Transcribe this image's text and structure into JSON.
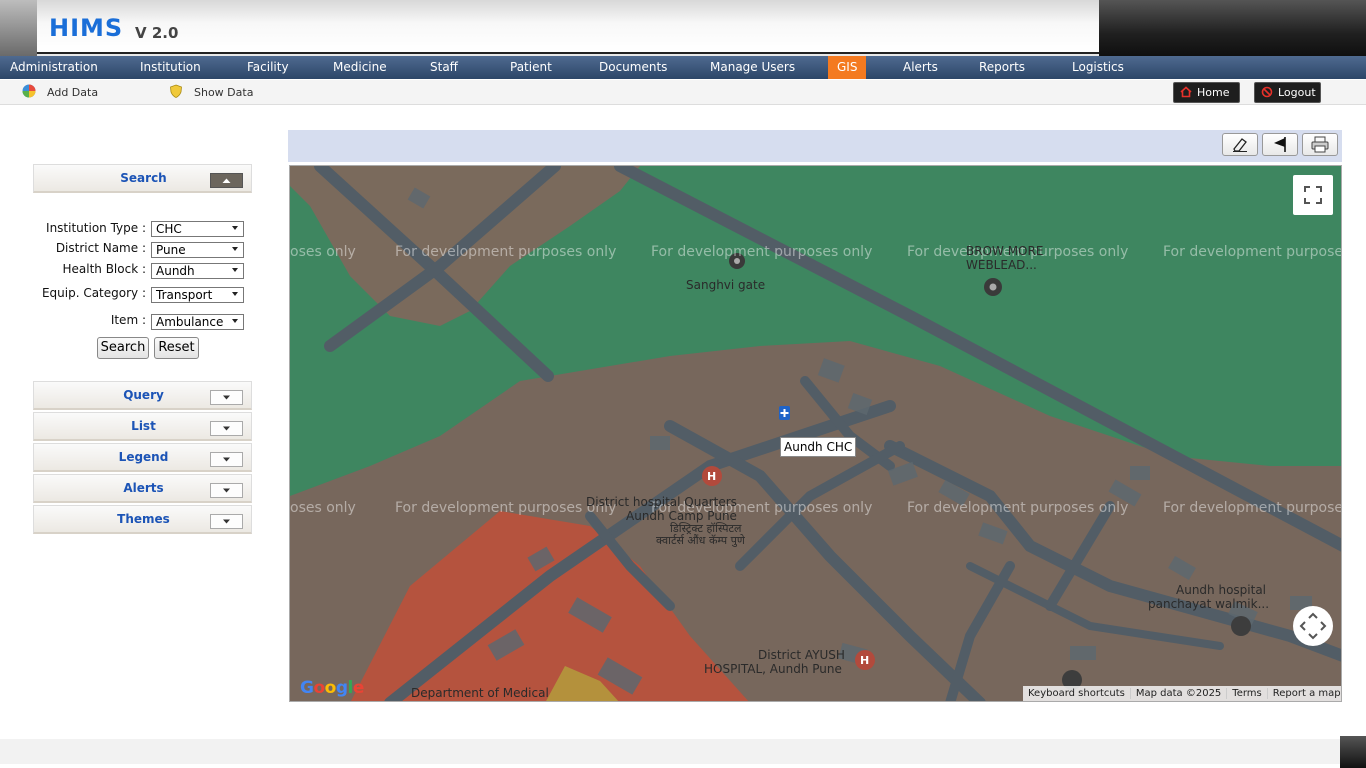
{
  "header": {
    "logo": "HIMS",
    "version": "V 2.0"
  },
  "nav": {
    "items": [
      {
        "label": "Administration"
      },
      {
        "label": "Institution"
      },
      {
        "label": "Facility"
      },
      {
        "label": "Medicine"
      },
      {
        "label": "Staff"
      },
      {
        "label": "Patient"
      },
      {
        "label": "Documents"
      },
      {
        "label": "Manage Users"
      },
      {
        "label": "GIS",
        "active": true
      },
      {
        "label": "Alerts"
      },
      {
        "label": "Reports"
      },
      {
        "label": "Logistics"
      }
    ],
    "active_color": "#f47a20"
  },
  "subnav": {
    "add_data": "Add Data",
    "show_data": "Show Data",
    "home": "Home",
    "logout": "Logout"
  },
  "left_panel": {
    "search": {
      "title": "Search",
      "fields": [
        {
          "label": "Institution Type :",
          "value": "CHC"
        },
        {
          "label": "District Name :",
          "value": "Pune"
        },
        {
          "label": "Health Block :",
          "value": "Aundh"
        },
        {
          "label": "Equip. Category :",
          "value": "Transport"
        },
        {
          "label": "Item :",
          "value": "Ambulance"
        }
      ],
      "search_button": "Search",
      "reset_button": "Reset"
    },
    "sections": [
      "Query",
      "List",
      "Legend",
      "Alerts",
      "Themes"
    ]
  },
  "map": {
    "watermark": "For development purposes only",
    "watermark_cut_left": "oses only",
    "watermark_cut_right": "For development purposes",
    "marker_tooltip": "Aundh CHC",
    "places": {
      "sanghvi": "Sanghvi gate",
      "brow": "BROW MORE",
      "weblead": "WEBLEAD...",
      "district_hospital": "District hospital Quarters",
      "aundh_camp": "Aundh Camp Pune",
      "marathi_1": "डिस्ट्रिक्ट हॉस्पिटल",
      "marathi_2": "क्वार्टर्स औंध कॅम्प पुणे",
      "ayush_1": "District AYUSH",
      "ayush_2": "HOSPITAL, Aundh Pune",
      "aundh_hosp_1": "Aundh hospital",
      "aundh_hosp_2": "panchayat walmik...",
      "dept": "Department of Medical"
    },
    "attribution": {
      "shortcuts": "Keyboard shortcuts",
      "data": "Map data ©2025",
      "terms": "Terms",
      "report": "Report a map error"
    },
    "google_logo": "Google"
  }
}
